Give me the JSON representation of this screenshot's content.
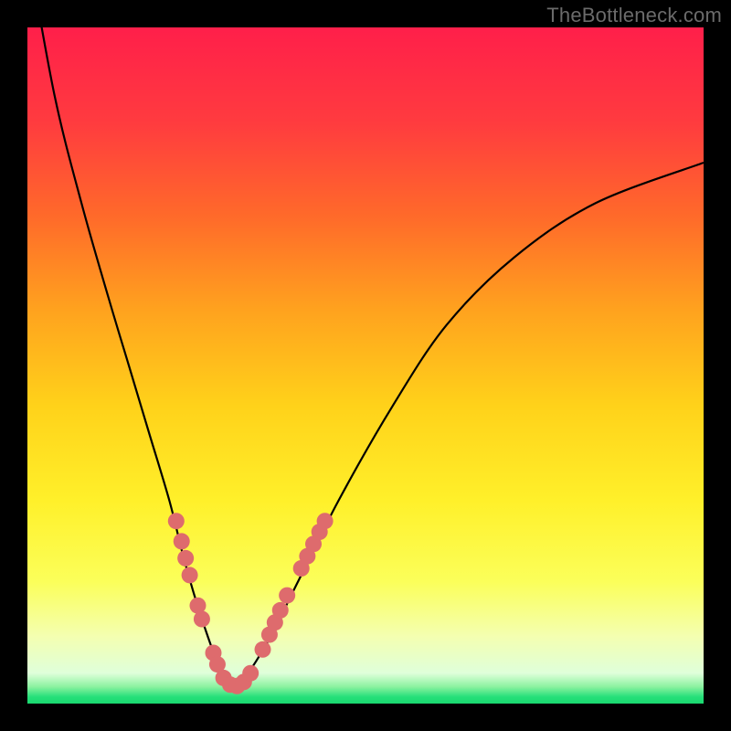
{
  "watermark": "TheBottleneck.com",
  "gradient_stops": [
    {
      "offset": 0.0,
      "color": "#ff1f4a"
    },
    {
      "offset": 0.14,
      "color": "#ff3b3f"
    },
    {
      "offset": 0.28,
      "color": "#ff6a2a"
    },
    {
      "offset": 0.42,
      "color": "#ffa31e"
    },
    {
      "offset": 0.56,
      "color": "#ffd21a"
    },
    {
      "offset": 0.7,
      "color": "#fff02a"
    },
    {
      "offset": 0.82,
      "color": "#fbff5a"
    },
    {
      "offset": 0.9,
      "color": "#f4ffb0"
    },
    {
      "offset": 0.955,
      "color": "#dfffda"
    },
    {
      "offset": 0.975,
      "color": "#8cf2a0"
    },
    {
      "offset": 0.99,
      "color": "#26e07a"
    },
    {
      "offset": 1.0,
      "color": "#19d86f"
    }
  ],
  "chart_data": {
    "type": "line",
    "title": "",
    "xlabel": "",
    "ylabel": "",
    "xlim": [
      0,
      100
    ],
    "ylim": [
      0,
      100
    ],
    "series": [
      {
        "name": "bottleneck-curve",
        "x": [
          0,
          4,
          8,
          12,
          15,
          18,
          21,
          23,
          25,
          27,
          28.5,
          30,
          31,
          33,
          36,
          40,
          46,
          54,
          62,
          72,
          84,
          100
        ],
        "y": [
          112,
          90,
          74,
          60,
          50,
          40,
          30,
          22,
          15,
          9,
          5,
          2.5,
          2.5,
          5,
          10,
          18,
          30,
          44,
          56,
          66,
          74,
          80
        ]
      }
    ],
    "highlight_points": {
      "name": "marker-dots",
      "color": "#de6b6d",
      "points": [
        {
          "x": 22.0,
          "y": 27.0
        },
        {
          "x": 22.8,
          "y": 24.0
        },
        {
          "x": 23.4,
          "y": 21.5
        },
        {
          "x": 24.0,
          "y": 19.0
        },
        {
          "x": 25.2,
          "y": 14.5
        },
        {
          "x": 25.8,
          "y": 12.5
        },
        {
          "x": 27.5,
          "y": 7.5
        },
        {
          "x": 28.1,
          "y": 5.8
        },
        {
          "x": 29.0,
          "y": 3.8
        },
        {
          "x": 30.0,
          "y": 2.8
        },
        {
          "x": 31.0,
          "y": 2.6
        },
        {
          "x": 32.0,
          "y": 3.2
        },
        {
          "x": 33.0,
          "y": 4.5
        },
        {
          "x": 34.8,
          "y": 8.0
        },
        {
          "x": 35.8,
          "y": 10.2
        },
        {
          "x": 36.6,
          "y": 12.0
        },
        {
          "x": 37.4,
          "y": 13.8
        },
        {
          "x": 38.4,
          "y": 16.0
        },
        {
          "x": 40.5,
          "y": 20.0
        },
        {
          "x": 41.4,
          "y": 21.8
        },
        {
          "x": 42.3,
          "y": 23.6
        },
        {
          "x": 43.2,
          "y": 25.4
        },
        {
          "x": 44.0,
          "y": 27.0
        }
      ]
    }
  }
}
